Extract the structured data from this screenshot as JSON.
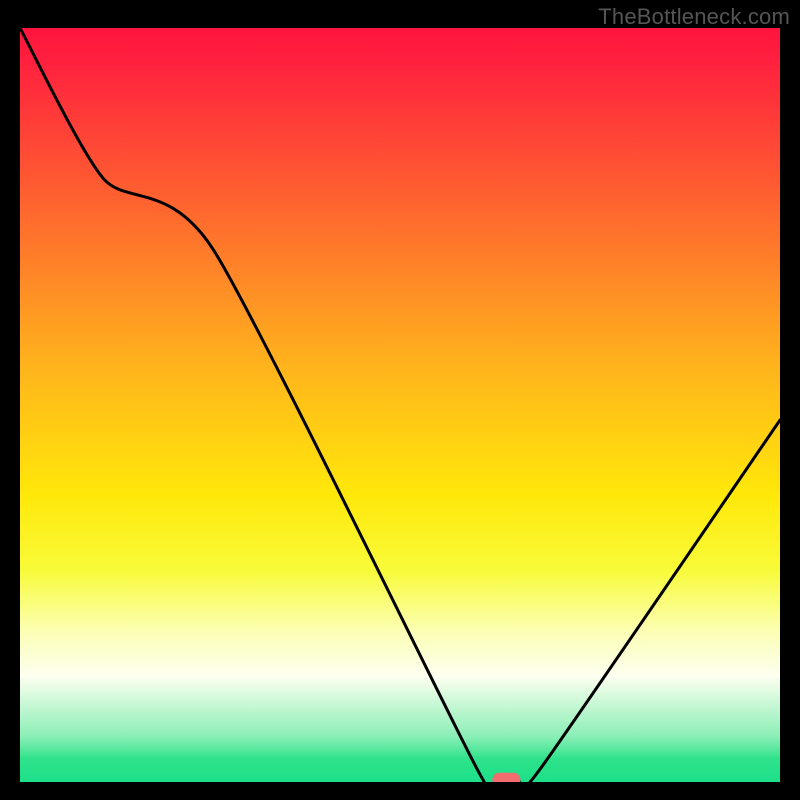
{
  "watermark": "TheBottleneck.com",
  "chart_data": {
    "type": "line",
    "title": "",
    "xlabel": "",
    "ylabel": "",
    "xlim": [
      0,
      100
    ],
    "ylim": [
      0,
      100
    ],
    "background_gradient": {
      "stops": [
        {
          "offset": 0.0,
          "color": "#ff143c"
        },
        {
          "offset": 0.04,
          "color": "#ff1f3f"
        },
        {
          "offset": 0.25,
          "color": "#ff6a2e"
        },
        {
          "offset": 0.45,
          "color": "#ffb41c"
        },
        {
          "offset": 0.62,
          "color": "#ffe80a"
        },
        {
          "offset": 0.72,
          "color": "#f8fb3a"
        },
        {
          "offset": 0.8,
          "color": "#fcffb4"
        },
        {
          "offset": 0.86,
          "color": "#fdfff0"
        },
        {
          "offset": 0.94,
          "color": "#8aefb6"
        },
        {
          "offset": 0.97,
          "color": "#2de28a"
        },
        {
          "offset": 1.0,
          "color": "#1de08a"
        }
      ]
    },
    "series": [
      {
        "name": "bottleneck-curve",
        "color": "#000000",
        "x": [
          0.0,
          11.0,
          25.5,
          60.0,
          62.5,
          65.5,
          68.5,
          100.0
        ],
        "y": [
          100.0,
          80.0,
          70.5,
          2.0,
          0.3,
          0.3,
          1.8,
          48.0
        ]
      }
    ],
    "marker": {
      "name": "optimal-point",
      "x": 64.0,
      "y": 0.3,
      "color": "#f26d6d"
    }
  }
}
